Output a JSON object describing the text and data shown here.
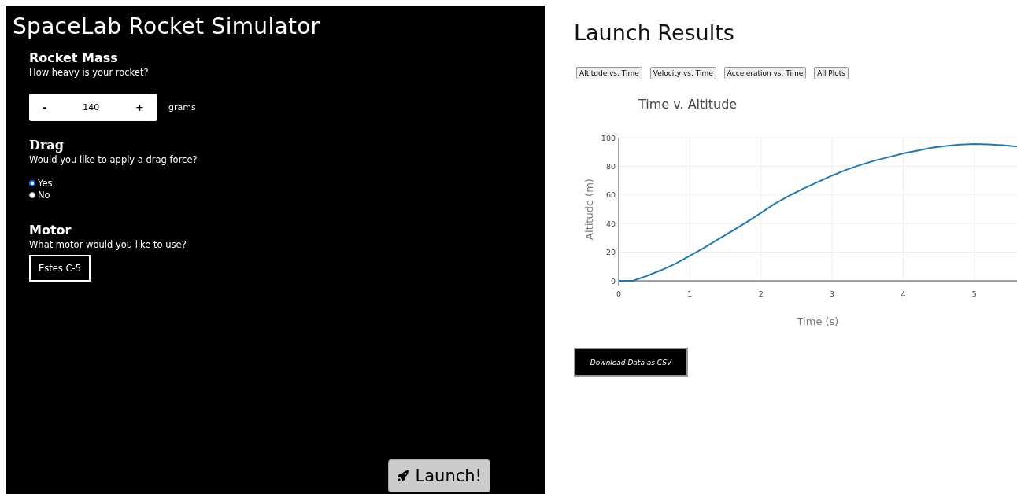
{
  "simulator": {
    "title": "SpaceLab Rocket Simulator",
    "mass": {
      "heading": "Rocket Mass",
      "question": "How heavy is your rocket?",
      "decrement": "-",
      "value": "140",
      "increment": "+",
      "unit": "grams"
    },
    "drag": {
      "heading": "Drag",
      "question": "Would you like to apply a drag force?",
      "options": [
        {
          "label": "Yes",
          "selected": true
        },
        {
          "label": "No",
          "selected": false
        }
      ]
    },
    "motor": {
      "heading": "Motor",
      "question": "What motor would you like to use?",
      "value": "Estes C-5"
    },
    "launch_button": "Launch!"
  },
  "results": {
    "title": "Launch Results",
    "plot_buttons": [
      "Altitude vs. Time",
      "Velocity vs. Time",
      "Acceleration vs. Time",
      "All Plots"
    ],
    "chart_data": {
      "type": "line",
      "title": "Time v. Altitude",
      "xlabel": "Time (s)",
      "ylabel": "Altitude (m)",
      "x": [
        0,
        0.2,
        0.4,
        0.6,
        0.8,
        1,
        1.2,
        1.4,
        1.6,
        1.8,
        2,
        2.2,
        2.4,
        2.6,
        2.8,
        3,
        3.2,
        3.4,
        3.6,
        3.8,
        4,
        4.2,
        4.4,
        4.6,
        4.8,
        5,
        5.2,
        5.4,
        5.6
      ],
      "series": [
        {
          "color": "#1f77b4",
          "values": [
            0,
            0,
            3.5,
            7.5,
            12,
            17.5,
            23,
            29,
            35,
            41,
            47.5,
            54,
            59.5,
            64.5,
            69,
            73.5,
            77.5,
            81,
            84,
            86.5,
            89,
            91,
            93,
            94.3,
            95.2,
            95.6,
            95.4,
            94.8,
            93.8
          ]
        }
      ],
      "xlim": [
        0,
        5.6
      ],
      "ylim": [
        0,
        100
      ],
      "xticks": [
        0,
        1,
        2,
        3,
        4,
        5
      ],
      "yticks": [
        0,
        20,
        40,
        60,
        80,
        100
      ],
      "grid": true
    },
    "download_button": "Download Data as CSV"
  }
}
